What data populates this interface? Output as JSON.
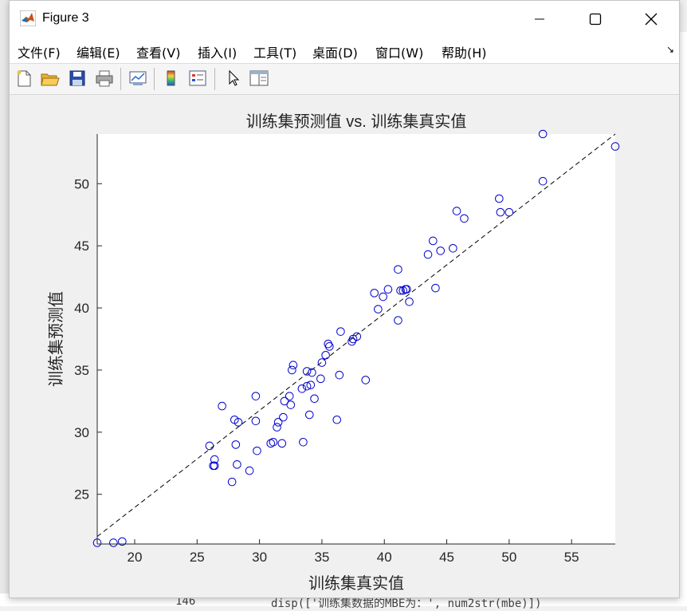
{
  "background": {
    "code_line": "disp(['训练集数据的MBE为：', num2str(mbe)])",
    "line_number": "146"
  },
  "window": {
    "title": "Figure 3",
    "icon": "matlab-logo-icon",
    "controls": [
      "minimize-icon",
      "maximize-icon",
      "close-icon"
    ]
  },
  "menu": {
    "items": [
      "文件(F)",
      "编辑(E)",
      "查看(V)",
      "插入(I)",
      "工具(T)",
      "桌面(D)",
      "窗口(W)",
      "帮助(H)"
    ],
    "overflow_icon": "dock-arrow-icon"
  },
  "toolbar": {
    "tools": [
      "new-figure-icon",
      "open-file-icon",
      "save-icon",
      "print-icon",
      "link-plot-icon",
      "colorbar-icon",
      "legend-icon",
      "pointer-icon",
      "property-inspector-icon"
    ]
  },
  "chart_data": {
    "type": "scatter",
    "title": "训练集预测值 vs. 训练集真实值",
    "xlabel": "训练集真实值",
    "ylabel": "训练集预测值",
    "xlim": [
      17,
      58.5
    ],
    "ylim": [
      21,
      54
    ],
    "xticks": [
      20,
      25,
      30,
      35,
      40,
      45,
      50,
      55
    ],
    "yticks": [
      25,
      30,
      35,
      40,
      45,
      50
    ],
    "grid": false,
    "marker_color": "#0000cc",
    "marker": "open-circle",
    "reference_line": {
      "x": [
        17,
        58.5
      ],
      "y": [
        21.6,
        54
      ],
      "style": "dashed",
      "color": "#000000"
    },
    "points": [
      [
        17.0,
        21.1
      ],
      [
        18.3,
        21.1
      ],
      [
        19.0,
        21.2
      ],
      [
        26.0,
        28.9
      ],
      [
        26.3,
        27.3
      ],
      [
        26.4,
        27.3
      ],
      [
        26.4,
        27.8
      ],
      [
        27.0,
        32.1
      ],
      [
        27.8,
        26.0
      ],
      [
        28.0,
        31.0
      ],
      [
        28.1,
        29.0
      ],
      [
        28.2,
        27.4
      ],
      [
        28.3,
        30.8
      ],
      [
        29.2,
        26.9
      ],
      [
        29.7,
        30.9
      ],
      [
        29.7,
        32.9
      ],
      [
        29.8,
        28.5
      ],
      [
        30.9,
        29.1
      ],
      [
        31.1,
        29.2
      ],
      [
        31.4,
        30.4
      ],
      [
        31.5,
        30.8
      ],
      [
        31.8,
        29.1
      ],
      [
        31.9,
        31.2
      ],
      [
        32.0,
        32.5
      ],
      [
        32.4,
        32.9
      ],
      [
        32.5,
        32.2
      ],
      [
        32.6,
        35.0
      ],
      [
        32.7,
        35.4
      ],
      [
        33.4,
        33.5
      ],
      [
        33.5,
        29.2
      ],
      [
        33.8,
        33.7
      ],
      [
        33.8,
        34.9
      ],
      [
        34.0,
        31.4
      ],
      [
        34.1,
        33.8
      ],
      [
        34.2,
        34.8
      ],
      [
        34.4,
        32.7
      ],
      [
        34.9,
        34.3
      ],
      [
        35.0,
        35.6
      ],
      [
        35.3,
        36.2
      ],
      [
        35.5,
        37.1
      ],
      [
        35.6,
        36.9
      ],
      [
        36.2,
        31.0
      ],
      [
        36.4,
        34.6
      ],
      [
        36.5,
        38.1
      ],
      [
        37.4,
        37.3
      ],
      [
        37.5,
        37.5
      ],
      [
        37.8,
        37.7
      ],
      [
        38.5,
        34.2
      ],
      [
        39.2,
        41.2
      ],
      [
        39.5,
        39.9
      ],
      [
        39.9,
        40.9
      ],
      [
        40.3,
        41.5
      ],
      [
        41.1,
        43.1
      ],
      [
        41.1,
        39.0
      ],
      [
        41.3,
        41.4
      ],
      [
        41.5,
        41.4
      ],
      [
        41.7,
        41.5
      ],
      [
        41.8,
        41.5
      ],
      [
        42.0,
        40.5
      ],
      [
        43.5,
        44.3
      ],
      [
        43.9,
        45.4
      ],
      [
        44.1,
        41.6
      ],
      [
        44.5,
        44.6
      ],
      [
        45.5,
        44.8
      ],
      [
        45.8,
        47.8
      ],
      [
        46.4,
        47.2
      ],
      [
        49.2,
        48.8
      ],
      [
        49.3,
        47.7
      ],
      [
        50.0,
        47.7
      ],
      [
        52.7,
        54.0
      ],
      [
        52.7,
        50.2
      ],
      [
        58.5,
        53.0
      ]
    ]
  }
}
